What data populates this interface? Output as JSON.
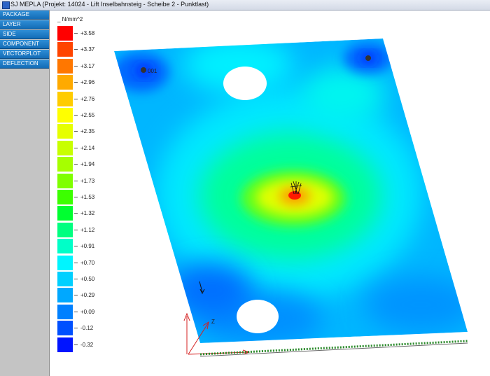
{
  "window": {
    "title": "SJ MEPLA (Projekt: 14024 - Lift Inselbahnsteig - Scheibe 2 - Punktlast)"
  },
  "sidebar": {
    "items": [
      {
        "label": "PACKAGE"
      },
      {
        "label": "LAYER"
      },
      {
        "label": "SIDE"
      },
      {
        "label": "COMPONENT"
      },
      {
        "label": "VECTORPLOT"
      },
      {
        "label": "DEFLECTION"
      }
    ]
  },
  "legend": {
    "unit": "_ N/mm^2",
    "entries": [
      {
        "value": "+3.58",
        "color": "#ff0000"
      },
      {
        "value": "+3.37",
        "color": "#ff4400"
      },
      {
        "value": "+3.17",
        "color": "#ff7700"
      },
      {
        "value": "+2.96",
        "color": "#ffaa00"
      },
      {
        "value": "+2.76",
        "color": "#ffcc00"
      },
      {
        "value": "+2.55",
        "color": "#ffff00"
      },
      {
        "value": "+2.35",
        "color": "#e6ff00"
      },
      {
        "value": "+2.14",
        "color": "#c8ff00"
      },
      {
        "value": "+1.94",
        "color": "#a6ff00"
      },
      {
        "value": "+1.73",
        "color": "#7fff00"
      },
      {
        "value": "+1.53",
        "color": "#3cff00"
      },
      {
        "value": "+1.32",
        "color": "#00ff30"
      },
      {
        "value": "+1.12",
        "color": "#00ff80"
      },
      {
        "value": "+0.91",
        "color": "#00ffc8"
      },
      {
        "value": "+0.70",
        "color": "#00f5ff"
      },
      {
        "value": "+0.50",
        "color": "#00d0ff"
      },
      {
        "value": "+0.29",
        "color": "#00a8ff"
      },
      {
        "value": "+0.09",
        "color": "#0080ff"
      },
      {
        "value": "-0.12",
        "color": "#0050ff"
      },
      {
        "value": "-0.32",
        "color": "#0014ff"
      }
    ]
  },
  "model": {
    "support_label": "001",
    "axis_label": "Z"
  }
}
